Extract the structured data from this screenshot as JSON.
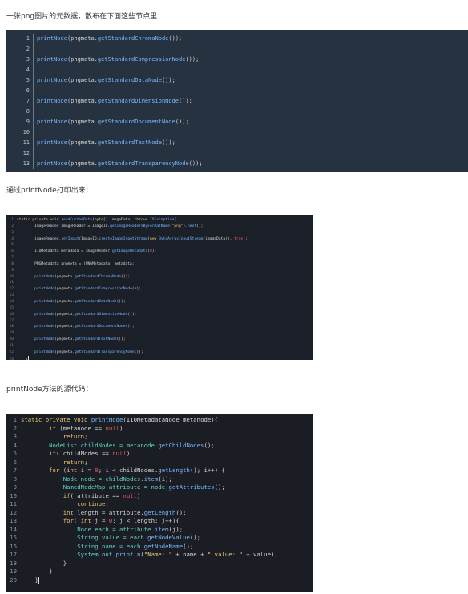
{
  "intro_text": "一张png图片的元数据，散布在下面这些节点里：",
  "mid_text": "通过printNode打印出来：",
  "source_text": "printNode方法的源代码：",
  "colors": {
    "plain": "#d4d4d4",
    "keyword": "#f0c674",
    "method": "#76b8ff",
    "teal": "#5fd3c4",
    "literal": "#e65c5c",
    "comment": "#7f8c99"
  },
  "block1": {
    "lines": [
      {
        "n": "1",
        "t": [
          [
            "printNode",
            "method"
          ],
          [
            "(pngmeta.",
            "plain"
          ],
          [
            "getStandardChromaNode",
            "method"
          ],
          [
            "());",
            "plain"
          ]
        ]
      },
      {
        "n": "2",
        "t": []
      },
      {
        "n": "3",
        "t": [
          [
            "printNode",
            "method"
          ],
          [
            "(pngmeta.",
            "plain"
          ],
          [
            "getStandardCompressionNode",
            "method"
          ],
          [
            "());",
            "plain"
          ]
        ]
      },
      {
        "n": "4",
        "t": []
      },
      {
        "n": "5",
        "t": [
          [
            "printNode",
            "method"
          ],
          [
            "(pngmeta.",
            "plain"
          ],
          [
            "getStandardDataNode",
            "method"
          ],
          [
            "());",
            "plain"
          ]
        ]
      },
      {
        "n": "6",
        "t": []
      },
      {
        "n": "7",
        "t": [
          [
            "printNode",
            "method"
          ],
          [
            "(pngmeta.",
            "plain"
          ],
          [
            "getStandardDimensionNode",
            "method"
          ],
          [
            "());",
            "plain"
          ]
        ]
      },
      {
        "n": "8",
        "t": []
      },
      {
        "n": "9",
        "t": [
          [
            "printNode",
            "method"
          ],
          [
            "(pngmeta.",
            "plain"
          ],
          [
            "getStandardDocumentNode",
            "method"
          ],
          [
            "());",
            "plain"
          ]
        ]
      },
      {
        "n": "10",
        "t": []
      },
      {
        "n": "11",
        "t": [
          [
            "printNode",
            "method"
          ],
          [
            "(pngmeta.",
            "plain"
          ],
          [
            "getStandardTextNode",
            "method"
          ],
          [
            "());",
            "plain"
          ]
        ]
      },
      {
        "n": "12",
        "t": []
      },
      {
        "n": "13",
        "t": [
          [
            "printNode",
            "method"
          ],
          [
            "(pngmeta.",
            "plain"
          ],
          [
            "getStandardTransparencyNode",
            "method"
          ],
          [
            "());",
            "plain"
          ]
        ]
      }
    ]
  },
  "block2": {
    "lines": [
      {
        "n": "1",
        "t": [
          [
            "static private void ",
            "keyword"
          ],
          [
            "readCustomData",
            "method"
          ],
          [
            "(",
            "plain"
          ],
          [
            "byte",
            "keyword"
          ],
          [
            "[] imageData) ",
            "plain"
          ],
          [
            "throws ",
            "keyword"
          ],
          [
            "IOException",
            "method"
          ],
          [
            "{",
            "plain"
          ]
        ]
      },
      {
        "n": "2",
        "t": [
          [
            "        ImageReader imageReader = ImageIO.",
            "plain"
          ],
          [
            "getImageReadersByFormatName",
            "method"
          ],
          [
            "(",
            "plain"
          ],
          [
            "\"png\"",
            "keyword"
          ],
          [
            ").",
            "plain"
          ],
          [
            "next",
            "method"
          ],
          [
            "();",
            "plain"
          ]
        ]
      },
      {
        "n": "3",
        "t": []
      },
      {
        "n": "4",
        "t": [
          [
            "        imageReader.",
            "plain"
          ],
          [
            "setInput",
            "method"
          ],
          [
            "(ImageIO.",
            "plain"
          ],
          [
            "createImageInputStream",
            "method"
          ],
          [
            "(",
            "plain"
          ],
          [
            "new ",
            "keyword"
          ],
          [
            "ByteArrayInputStream",
            "method"
          ],
          [
            "(imageData)), ",
            "plain"
          ],
          [
            "true",
            "literal"
          ],
          [
            ");",
            "plain"
          ]
        ]
      },
      {
        "n": "5",
        "t": []
      },
      {
        "n": "6",
        "t": [
          [
            "        IIOMetadata metadata = imageReader.",
            "plain"
          ],
          [
            "getImageMetadata",
            "method"
          ],
          [
            "(",
            "plain"
          ],
          [
            "0",
            "literal"
          ],
          [
            ");",
            "plain"
          ]
        ]
      },
      {
        "n": "7",
        "t": []
      },
      {
        "n": "8",
        "t": [
          [
            "        PNGMetadata pngmeta = (PNGMetadata) metadata;",
            "plain"
          ]
        ]
      },
      {
        "n": "9",
        "t": []
      },
      {
        "n": "10",
        "t": [
          [
            "        ",
            "plain"
          ],
          [
            "printNode",
            "method"
          ],
          [
            "(pngmeta.",
            "plain"
          ],
          [
            "getStandardChromaNode",
            "method"
          ],
          [
            "());",
            "plain"
          ]
        ]
      },
      {
        "n": "11",
        "t": []
      },
      {
        "n": "12",
        "t": [
          [
            "        ",
            "plain"
          ],
          [
            "printNode",
            "method"
          ],
          [
            "(pngmeta.",
            "plain"
          ],
          [
            "getStandardCompressionNode",
            "method"
          ],
          [
            "());",
            "plain"
          ]
        ]
      },
      {
        "n": "13",
        "t": []
      },
      {
        "n": "14",
        "t": [
          [
            "        ",
            "plain"
          ],
          [
            "printNode",
            "method"
          ],
          [
            "(pngmeta.",
            "plain"
          ],
          [
            "getStandardDataNode",
            "method"
          ],
          [
            "());",
            "plain"
          ]
        ]
      },
      {
        "n": "15",
        "t": []
      },
      {
        "n": "16",
        "t": [
          [
            "        ",
            "plain"
          ],
          [
            "printNode",
            "method"
          ],
          [
            "(pngmeta.",
            "plain"
          ],
          [
            "getStandardDimensionNode",
            "method"
          ],
          [
            "());",
            "plain"
          ]
        ]
      },
      {
        "n": "17",
        "t": []
      },
      {
        "n": "18",
        "t": [
          [
            "        ",
            "plain"
          ],
          [
            "printNode",
            "method"
          ],
          [
            "(pngmeta.",
            "plain"
          ],
          [
            "getStandardDocumentNode",
            "method"
          ],
          [
            "());",
            "plain"
          ]
        ]
      },
      {
        "n": "19",
        "t": []
      },
      {
        "n": "20",
        "t": [
          [
            "        ",
            "plain"
          ],
          [
            "printNode",
            "method"
          ],
          [
            "(pngmeta.",
            "plain"
          ],
          [
            "getStandardTextNode",
            "method"
          ],
          [
            "());",
            "plain"
          ]
        ]
      },
      {
        "n": "21",
        "t": []
      },
      {
        "n": "22",
        "t": [
          [
            "        ",
            "plain"
          ],
          [
            "printNode",
            "method"
          ],
          [
            "(pngmeta.",
            "plain"
          ],
          [
            "getStandardTransparencyNode",
            "method"
          ],
          [
            "());",
            "plain"
          ]
        ]
      },
      {
        "n": "23",
        "t": [
          [
            "    }",
            "plain"
          ]
        ]
      }
    ]
  },
  "block3": {
    "lines": [
      {
        "n": "1",
        "t": [
          [
            "static private void ",
            "keyword"
          ],
          [
            "printNode",
            "method"
          ],
          [
            "(IIOMetadataNode metanode){",
            "plain"
          ]
        ]
      },
      {
        "n": "2",
        "t": [
          [
            "        ",
            "plain"
          ],
          [
            "if ",
            "keyword"
          ],
          [
            "(metanode == ",
            "plain"
          ],
          [
            "null",
            "literal"
          ],
          [
            ")",
            "plain"
          ]
        ]
      },
      {
        "n": "3",
        "t": [
          [
            "            ",
            "plain"
          ],
          [
            "return",
            "keyword"
          ],
          [
            ";",
            "plain"
          ]
        ]
      },
      {
        "n": "4",
        "t": [
          [
            "        NodeList childNodes = metanode.",
            "teal"
          ],
          [
            "getChildNodes",
            "method"
          ],
          [
            "();",
            "plain"
          ]
        ]
      },
      {
        "n": "5",
        "t": [
          [
            "        ",
            "plain"
          ],
          [
            "if",
            "keyword"
          ],
          [
            "( childNodes == ",
            "plain"
          ],
          [
            "null",
            "literal"
          ],
          [
            ")",
            "plain"
          ]
        ]
      },
      {
        "n": "6",
        "t": [
          [
            "            ",
            "plain"
          ],
          [
            "return",
            "keyword"
          ],
          [
            ";",
            "plain"
          ]
        ]
      },
      {
        "n": "7",
        "t": [
          [
            "        ",
            "plain"
          ],
          [
            "for ",
            "keyword"
          ],
          [
            "(",
            "plain"
          ],
          [
            "int ",
            "keyword"
          ],
          [
            "i = ",
            "plain"
          ],
          [
            "0",
            "literal"
          ],
          [
            "; i < childNodes.",
            "plain"
          ],
          [
            "getLength",
            "method"
          ],
          [
            "(); i++) {",
            "plain"
          ]
        ]
      },
      {
        "n": "8",
        "t": [
          [
            "            Node node = childNodes.",
            "teal"
          ],
          [
            "item",
            "method"
          ],
          [
            "(i);",
            "plain"
          ]
        ]
      },
      {
        "n": "9",
        "t": [
          [
            "            NamedNodeMap attribute = node.",
            "teal"
          ],
          [
            "getAttributes",
            "method"
          ],
          [
            "();",
            "plain"
          ]
        ]
      },
      {
        "n": "10",
        "t": [
          [
            "            ",
            "plain"
          ],
          [
            "if",
            "keyword"
          ],
          [
            "( attribute == ",
            "plain"
          ],
          [
            "null",
            "literal"
          ],
          [
            ")",
            "plain"
          ]
        ]
      },
      {
        "n": "11",
        "t": [
          [
            "                ",
            "plain"
          ],
          [
            "continue",
            "keyword"
          ],
          [
            ";",
            "plain"
          ]
        ]
      },
      {
        "n": "12",
        "t": [
          [
            "            ",
            "plain"
          ],
          [
            "int ",
            "keyword"
          ],
          [
            "length = attribute.",
            "plain"
          ],
          [
            "getLength",
            "method"
          ],
          [
            "();",
            "plain"
          ]
        ]
      },
      {
        "n": "13",
        "t": [
          [
            "            ",
            "plain"
          ],
          [
            "for",
            "keyword"
          ],
          [
            "( ",
            "plain"
          ],
          [
            "int ",
            "keyword"
          ],
          [
            "j = ",
            "plain"
          ],
          [
            "0",
            "literal"
          ],
          [
            "; j < length; j++){",
            "plain"
          ]
        ]
      },
      {
        "n": "14",
        "t": [
          [
            "                Node each = attribute.",
            "teal"
          ],
          [
            "item",
            "method"
          ],
          [
            "(j);",
            "plain"
          ]
        ]
      },
      {
        "n": "15",
        "t": [
          [
            "                String value = each.",
            "teal"
          ],
          [
            "getNodeValue",
            "method"
          ],
          [
            "();",
            "plain"
          ]
        ]
      },
      {
        "n": "16",
        "t": [
          [
            "                String name = each.",
            "teal"
          ],
          [
            "getNodeName",
            "method"
          ],
          [
            "();",
            "plain"
          ]
        ]
      },
      {
        "n": "17",
        "t": [
          [
            "                System.out.",
            "teal"
          ],
          [
            "println",
            "method"
          ],
          [
            "(",
            "plain"
          ],
          [
            "\"Name: \" ",
            "keyword"
          ],
          [
            "+ name + ",
            "plain"
          ],
          [
            "\" value: \" ",
            "keyword"
          ],
          [
            "+ value);",
            "plain"
          ]
        ]
      },
      {
        "n": "18",
        "t": [
          [
            "            }",
            "plain"
          ]
        ]
      },
      {
        "n": "19",
        "t": [
          [
            "        }",
            "plain"
          ]
        ]
      },
      {
        "n": "20",
        "t": [
          [
            "    }",
            "plain"
          ]
        ]
      }
    ]
  }
}
